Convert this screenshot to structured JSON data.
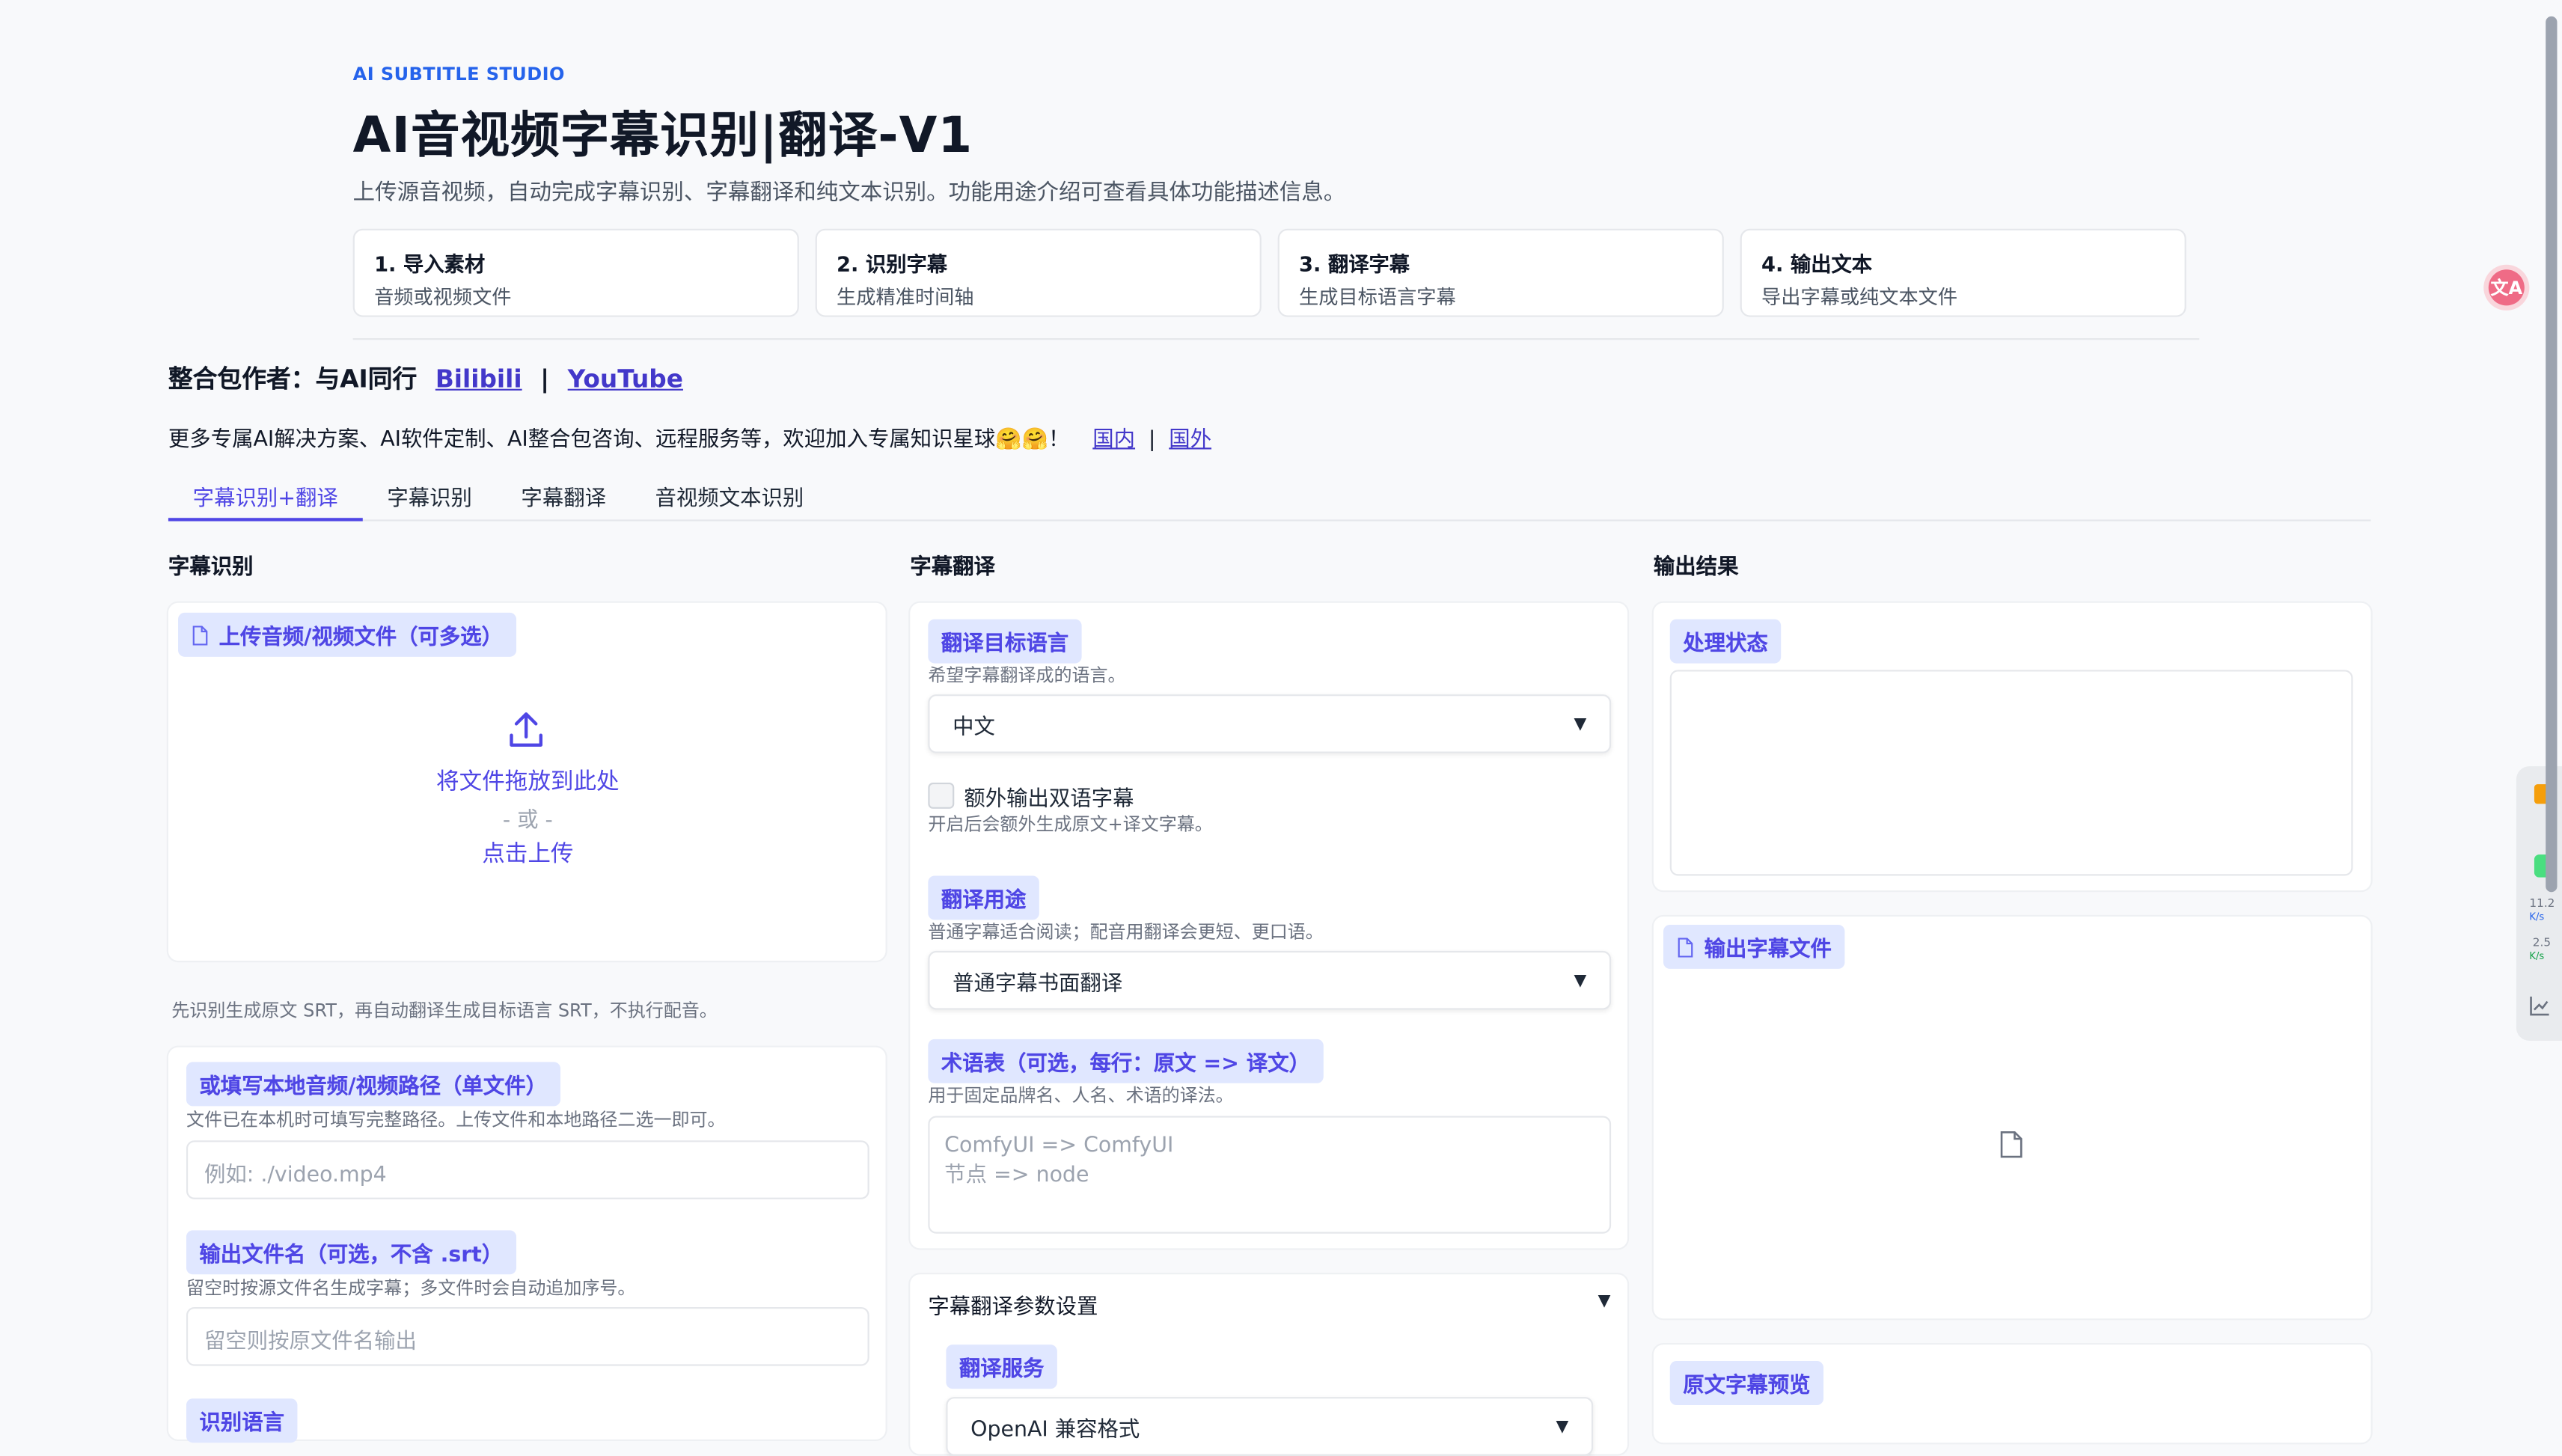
{
  "header": {
    "eyebrow": "AI SUBTITLE STUDIO",
    "title": "AI音视频字幕识别|翻译-V1",
    "subtitle": "上传源音视频，自动完成字幕识别、字幕翻译和纯文本识别。功能用途介绍可查看具体功能描述信息。",
    "steps": [
      {
        "title": "1. 导入素材",
        "desc": "音频或视频文件"
      },
      {
        "title": "2. 识别字幕",
        "desc": "生成精准时间轴"
      },
      {
        "title": "3. 翻译字幕",
        "desc": "生成目标语言字幕"
      },
      {
        "title": "4. 输出文本",
        "desc": "导出字幕或纯文本文件"
      }
    ]
  },
  "author": {
    "label": "整合包作者：与AI同行",
    "bilibili": "Bilibili",
    "separator": "|",
    "youtube": "YouTube"
  },
  "promo": {
    "text": "更多专属AI解决方案、AI软件定制、AI整合包咨询、远程服务等，欢迎加入专属知识星球🤗🤗！",
    "domestic": "国内",
    "separator": "|",
    "overseas": "国外"
  },
  "tabs": [
    "字幕识别+翻译",
    "字幕识别",
    "字幕翻译",
    "音视频文本识别"
  ],
  "left": {
    "title": "字幕识别",
    "upload_label": "上传音频/视频文件（可多选）",
    "drop_text": "将文件拖放到此处",
    "or_text": "- 或 -",
    "click_upload": "点击上传",
    "note": "先识别生成原文 SRT，再自动翻译生成目标语言 SRT，不执行配音。",
    "path_label": "或填写本地音频/视频路径（单文件）",
    "path_hint": "文件已在本机时可填写完整路径。上传文件和本地路径二选一即可。",
    "path_placeholder": "例如: ./video.mp4",
    "output_name_label": "输出文件名（可选，不含 .srt）",
    "output_name_hint": "留空时按源文件名生成字幕；多文件时会自动追加序号。",
    "output_name_placeholder": "留空则按原文件名输出",
    "lang_label": "识别语言"
  },
  "middle": {
    "title": "字幕翻译",
    "target_lang_label": "翻译目标语言",
    "target_lang_hint": "希望字幕翻译成的语言。",
    "target_lang_value": "中文",
    "bilingual_label": "额外输出双语字幕",
    "bilingual_hint": "开启后会额外生成原文+译文字幕。",
    "purpose_label": "翻译用途",
    "purpose_hint": "普通字幕适合阅读；配音用翻译会更短、更口语。",
    "purpose_value": "普通字幕书面翻译",
    "glossary_label": "术语表（可选，每行：原文 => 译文）",
    "glossary_hint": "用于固定品牌名、人名、术语的译法。",
    "glossary_placeholder_1": "ComfyUI => ComfyUI",
    "glossary_placeholder_2": "节点 => node",
    "params_label": "字幕翻译参数设置",
    "service_label": "翻译服务",
    "service_value": "OpenAI 兼容格式"
  },
  "right": {
    "title": "输出结果",
    "status_label": "处理状态",
    "file_label": "输出字幕文件",
    "preview_label": "原文字幕预览"
  },
  "side_widget": {
    "up_speed": "11.2",
    "up_unit": "K/s",
    "down_speed": "2.5",
    "down_unit": "K/s"
  },
  "float_button": {
    "glyph": "文A"
  },
  "colors": {
    "accent": "#4f46e5",
    "chip_bg": "#e0e7ff",
    "link": "#4338ca"
  }
}
